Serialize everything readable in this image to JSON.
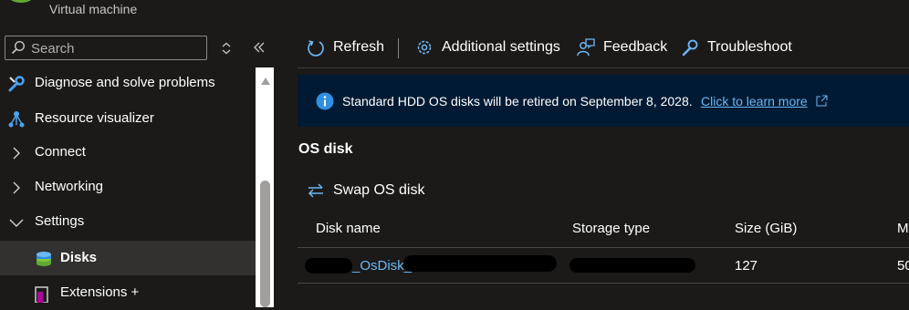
{
  "header": {
    "subtitle": "Virtual machine",
    "icon": "vm-icon"
  },
  "sidebar": {
    "search": {
      "placeholder": "Search",
      "value": ""
    },
    "items": [
      {
        "label": "Diagnose and solve problems",
        "icon": "wrench-icon"
      },
      {
        "label": "Resource visualizer",
        "icon": "hierarchy-icon"
      },
      {
        "label": "Connect",
        "icon": "chevron-right-icon"
      },
      {
        "label": "Networking",
        "icon": "chevron-right-icon"
      },
      {
        "label": "Settings",
        "icon": "chevron-down-icon"
      },
      {
        "label": "Disks",
        "icon": "disks-icon",
        "selected": true
      },
      {
        "label": "Extensions +",
        "icon": "extensions-icon"
      }
    ]
  },
  "toolbar": {
    "refresh": "Refresh",
    "additional_settings": "Additional settings",
    "feedback": "Feedback",
    "troubleshoot": "Troubleshoot"
  },
  "banner": {
    "message": "Standard HDD OS disks will be retired on September 8, 2028.",
    "link": "Click to learn more"
  },
  "os_disk": {
    "title": "OS disk",
    "swap_label": "Swap OS disk",
    "columns": [
      "Disk name",
      "Storage type",
      "Size (GiB)",
      "M"
    ],
    "rows": [
      {
        "disk_name": "_OsDisk_",
        "storage_type": "",
        "size": "127",
        "extra": "50"
      }
    ]
  },
  "colors": {
    "accent": "#6cb8f6",
    "banner_bg": "#001a33",
    "background": "#1b1a19"
  }
}
